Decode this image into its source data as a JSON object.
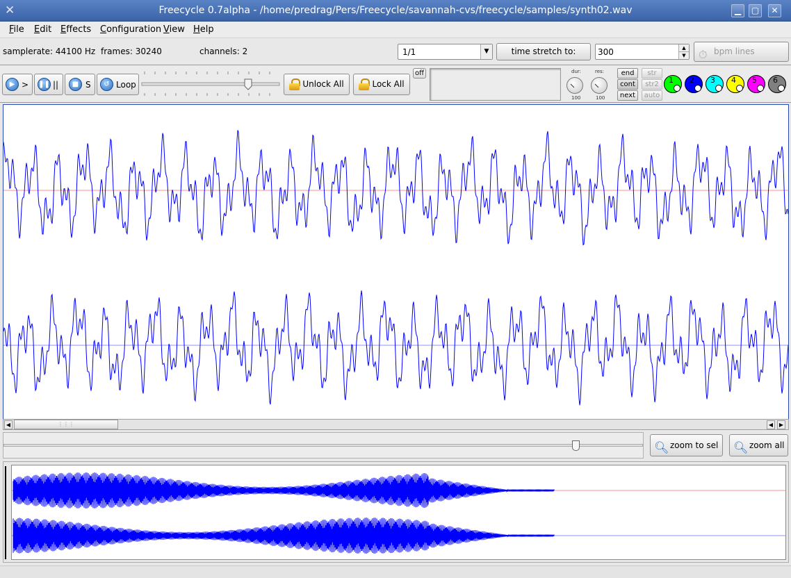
{
  "window": {
    "title": "Freecycle 0.7alpha - /home/predrag/Pers/Freecycle/savannah-cvs/freecycle/samples/synth02.wav",
    "minimize": "▁",
    "maximize": "▢",
    "close": "✕"
  },
  "menu": {
    "items": [
      "File",
      "Edit",
      "Effects",
      "Configuration",
      "View",
      "Help"
    ]
  },
  "info": {
    "samplerate": "samplerate: 44100 Hz",
    "frames": "frames: 30240",
    "channels": "channels: 2",
    "ratio_value": "1/1",
    "time_stretch_label": "time stretch to:",
    "time_stretch_value": "300",
    "bpm_lines": "bpm lines"
  },
  "transport": {
    "play": ">",
    "pause": "||",
    "stop": "S",
    "loop": "Loop",
    "unlock_all": "Unlock All",
    "lock_all": "Lock All",
    "off": "off"
  },
  "knobs": {
    "dur_label": "dur:",
    "dur_value": "100",
    "res_label": "res:",
    "res_value": "100"
  },
  "small_buttons": {
    "end": "end",
    "cont": "cont",
    "next": "next",
    "str": "str",
    "str2": "str2",
    "auto": "auto"
  },
  "channels": [
    {
      "label": "1",
      "color": "#00ff00"
    },
    {
      "label": "2",
      "color": "#0000ff"
    },
    {
      "label": "3",
      "color": "#00ffff"
    },
    {
      "label": "4",
      "color": "#ffff00"
    },
    {
      "label": "5",
      "color": "#ff00ff"
    },
    {
      "label": "6",
      "color": "#808080"
    }
  ],
  "zoom": {
    "zoom_to_sel": "zoom to sel",
    "zoom_all": "zoom all"
  },
  "colors": {
    "waveform": "#0000ff",
    "center_line_top": "#ff9090",
    "center_line_bottom": "#9090ff"
  }
}
